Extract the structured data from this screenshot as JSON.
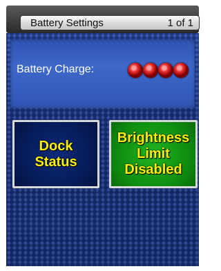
{
  "header": {
    "title": "Battery Settings",
    "page": "1 of 1"
  },
  "battery": {
    "label": "Battery Charge:",
    "indicator_count": 4,
    "indicator_color": "#e02b2b"
  },
  "tiles": {
    "dock": {
      "line1": "Dock",
      "line2": "Status"
    },
    "brightness": {
      "line1": "Brightness",
      "line2": "Limit",
      "line3": "Disabled"
    }
  },
  "colors": {
    "panel": "#1d3a8c",
    "tile_text": "#fff100",
    "active_tile": "#1fb51f",
    "inactive_tile": "#061a55"
  }
}
